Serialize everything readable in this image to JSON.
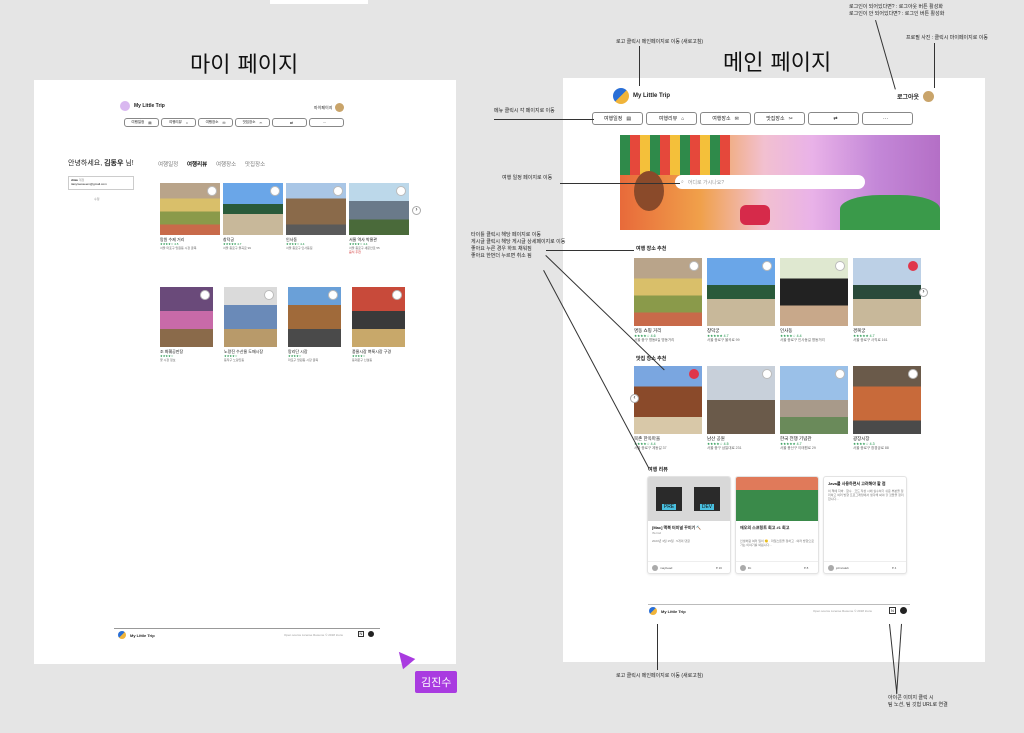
{
  "top_stub": "",
  "my_page": {
    "frame_title": "마이 페이지",
    "logo_text": "My Little Trip",
    "header_right": "마이페이지",
    "menu": [
      "여행일정",
      "여행리뷰",
      "여행장소",
      "맛집장소",
      "",
      "···"
    ],
    "menu_icons": [
      "▤",
      "⌂",
      "✉",
      "✂",
      "⇄",
      ""
    ],
    "greeting_prefix": "안녕하세요, ",
    "greeting_name": "김동우",
    "greeting_suffix": " 님!",
    "profile_id": "dmw",
    "profile_id_suffix": "계정",
    "profile_email": "tiasy/sesseem@gmail.com",
    "profile_edit": "수정",
    "tabs": [
      "여행일정",
      "여행리뷰",
      "여행장소",
      "맛집장소"
    ],
    "active_tab": "여행리뷰",
    "row1": [
      {
        "name": "망원 수제 거리",
        "stars": "★★★★☆ 4.5",
        "meta": "서울 마포구 망원동 시장 골목"
      },
      {
        "name": "창덕궁",
        "stars": "★★★★★ 4.7",
        "meta": "서울 종로구 율곡로 99"
      },
      {
        "name": "인사동",
        "stars": "★★★★☆ 4.4",
        "meta": "서울 종로구 인사동길"
      },
      {
        "name": "서울 역사 박물관",
        "stars": "★★★★☆ 4.4",
        "meta": "서울 종로구 새문안로 55",
        "extra": "음식 추천"
      }
    ],
    "row2": [
      {
        "name": "조 화훼공판장",
        "stars": "★★★★☆",
        "meta": "꽃 시장 정보"
      },
      {
        "name": "노량진 수산물 도매시장",
        "stars": "★★★★☆",
        "meta": "동작구 노량진동"
      },
      {
        "name": "망리단 시장",
        "stars": "★★★★☆",
        "meta": "마포구 망원동 시장 골목"
      },
      {
        "name": "풍물시장 벼룩시장 구경",
        "stars": "★★★★☆",
        "meta": "동대문구 신설동"
      }
    ],
    "footer_logo": "My Little Trip",
    "footer_copy": "Open source License  Resume  © 2018 Icons"
  },
  "main_page": {
    "frame_title": "메인 페이지",
    "logo_text": "My Little Trip",
    "logout": "로그아웃",
    "menu": [
      "여행일정",
      "여행리뷰",
      "여행장소",
      "맛집장소",
      "",
      "···"
    ],
    "menu_icons": [
      "▤",
      "⌂",
      "✉",
      "✂",
      "⇄",
      ""
    ],
    "search_placeholder": "어디로 가시나요?",
    "section_places": "여행 장소 추천",
    "places": [
      {
        "name": "명동 쇼핑 거리",
        "stars": "★★★★☆ 4.6",
        "meta": "서울 중구 명동8길 명동거리"
      },
      {
        "name": "창덕궁",
        "stars": "★★★★★ 4.7",
        "meta": "서울 종로구 율곡로 99"
      },
      {
        "name": "인사동",
        "stars": "★★★★☆ 4.4",
        "meta": "서울 종로구 인사동길 명동거리"
      },
      {
        "name": "경복궁",
        "stars": "★★★★★ 4.7",
        "meta": "서울 종로구 사직로 161"
      }
    ],
    "section_food": "맛집 장소 추천",
    "food": [
      {
        "name": "북촌 한옥마을",
        "stars": "★★★★☆ 4.4",
        "meta": "서울 종로구 계동길 37"
      },
      {
        "name": "남산 공원",
        "stars": "★★★★☆ 4.5",
        "meta": "서울 중구 삼일대로 231"
      },
      {
        "name": "한국 전쟁 기념관",
        "stars": "★★★★★ 4.7",
        "meta": "서울 용산구 이태원로 29"
      },
      {
        "name": "광장시장",
        "stars": "★★★★☆ 4.3",
        "meta": "서울 종로구 창경궁로 88"
      }
    ],
    "section_reviews": "여행 리뷰",
    "reviews": [
      {
        "title": "[Mac] 맥북 터미널 꾸미기 🔨",
        "sub": "iTerm2",
        "body": "2023년 3월 15일 · 5개의 댓글",
        "author": "maybead",
        "likes": "♥ 16",
        "pre": "PRE",
        "dev": "DEV"
      },
      {
        "title": "애오의 스프링트 회고 #1 회고",
        "sub": "",
        "body": "인생처럼 여러 일이 🙂 · 마일스톤을 정하고 · 여러 방향으로 가는 이야기를 써봅니다...",
        "author": "lbt",
        "likes": "♥ 8"
      },
      {
        "title": "Java를 사용하면서 고려해야 할 점",
        "sub": "",
        "body": "이 책에 자바 · 함수 · 코드 작성 시에 실수하기 쉬운 부분을 정리하고 여러 방향 프로그래밍에서 생각해 봐야 할 것들을 정리합니다...",
        "author": "johncaleb",
        "likes": "♥ 4"
      }
    ],
    "footer_logo": "My Little Trip",
    "footer_copy": "Open source License  Resume  © 2018 Icons"
  },
  "annotations": {
    "logo_note": "로고 클릭시 메인페이지로 이동 (새로고침)",
    "login_note_1": "로그인이 되어있다면? : 로그아웃 버튼 활성화",
    "login_note_2": "로그인이 안 되어있다면? : 로그인 버튼 활성화",
    "profile_note": "프로필 사진 : 클릭시 마이페이지로 이동",
    "menu_note": "메뉴 클릭시 각 페이지로 이동",
    "search_note": "여행 일정 페이지로 이동",
    "card_note_1": "타이틀 클릭시 해당 페이지로 이동",
    "card_note_2": "게시글 클릭시 해당 게시글 상세페이지로 이동",
    "card_note_3": "좋아요 누른 경우 하트 채워짐",
    "card_note_4": "좋아요 한번더 누르면 취소 됨",
    "footer_logo_note": "로고 클릭시 메인페이지로 이동 (새로고침)",
    "icon_note_1": "아이콘 이미지 클릭 시",
    "icon_note_2": "팀 노션, 팀 깃헙 URL로 연결"
  },
  "cursor_user": "김진수",
  "colors": {
    "accent_purple": "#a93be0",
    "star_green": "#0a8a3a",
    "canvas": "#e5e5e5"
  }
}
